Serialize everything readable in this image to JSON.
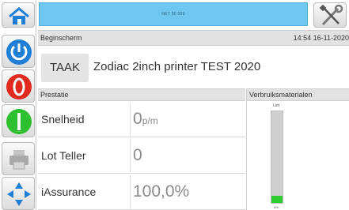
{
  "top_strip": {
    "text": "NET 00 000"
  },
  "breadcrumb": {
    "title": "Beginscherm",
    "datetime": "14:54 16-11-2020"
  },
  "job": {
    "label": "TAAK",
    "name": "Zodiac 2inch printer TEST 2020"
  },
  "performance": {
    "header": "Prestatie",
    "rows": [
      {
        "label": "Snelheid",
        "value": "0",
        "unit": "p/m"
      },
      {
        "label": "Lot Teller",
        "value": "0",
        "unit": ""
      },
      {
        "label": "iAssurance",
        "value": "100,0%",
        "unit": ""
      }
    ]
  },
  "consumables": {
    "header": "Verbruiksmaterialen",
    "ribbon": {
      "label": "Lint",
      "percent_text": "8%",
      "level_fraction": 0.08,
      "fill_color": "#2ecc2e"
    }
  },
  "sidebar": {
    "buttons": [
      {
        "icon": "home-icon"
      },
      {
        "icon": "power-icon",
        "color": "#1f7fd6"
      },
      {
        "icon": "stop-icon",
        "color": "#e02a20"
      },
      {
        "icon": "start-icon",
        "color": "#2fc02f"
      },
      {
        "icon": "printer-icon"
      },
      {
        "icon": "navigation-arrows-icon",
        "color": "#1f7fd6"
      }
    ]
  },
  "toolbar": {
    "tools_icon": "tools-icon"
  }
}
